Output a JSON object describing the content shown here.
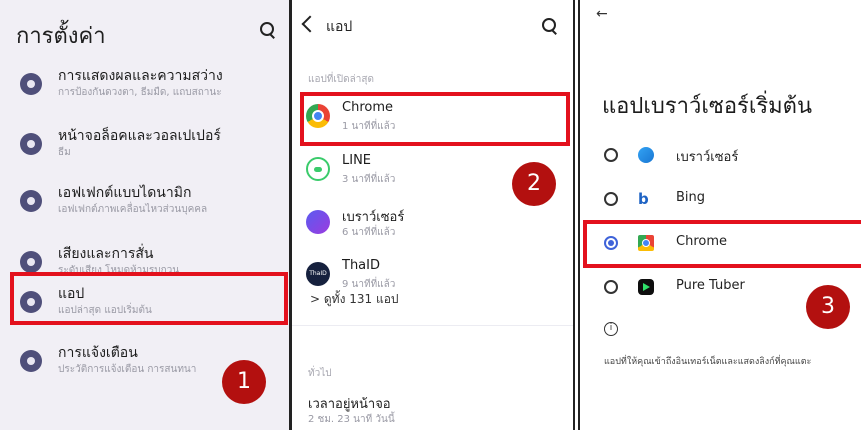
{
  "settings": {
    "title": "การตั้งค่า",
    "items": [
      {
        "title": "การแสดงผลและความสว่าง",
        "subtitle": "การป้องกันดวงตา, ธีมมืด, แถบสถานะ"
      },
      {
        "title": "หน้าจอล็อคและวอลเปเปอร์",
        "subtitle": "ธีม"
      },
      {
        "title": "เอฟเฟกต์แบบไดนามิก",
        "subtitle": "เอฟเฟกต์ภาพเคลื่อนไหวส่วนบุคคล"
      },
      {
        "title": "เสียงและการสั่น",
        "subtitle": "ระดับเสียง โหมดห้ามรบกวน"
      },
      {
        "title": "แอป",
        "subtitle": "แอปล่าสุด แอปเริ่มต้น"
      },
      {
        "title": "การแจ้งเตือน",
        "subtitle": "ประวัติการแจ้งเตือน การสนทนา"
      }
    ]
  },
  "apps": {
    "title": "แอป",
    "recent_header": "แอปที่เปิดล่าสุด",
    "recent": [
      {
        "name": "Chrome",
        "time": "1 นาทีที่แล้ว"
      },
      {
        "name": "LINE",
        "time": "3 นาทีที่แล้ว"
      },
      {
        "name": "เบราว์เซอร์",
        "time": "6 นาทีที่แล้ว"
      },
      {
        "name": "ThaID",
        "time": "9 นาทีที่แล้ว"
      }
    ],
    "thaid_icon_text": "ThaID",
    "see_all": "> ดูทั้ง 131 แอป",
    "general_header": "ทั่วไป",
    "screen_time_title": "เวลาอยู่หน้าจอ",
    "screen_time_value": "2 ชม. 23 นาที วันนี้"
  },
  "default_browser": {
    "back_glyph": "←",
    "title": "แอปเบราว์เซอร์เริ่มต้น",
    "options": [
      {
        "label": "เบราว์เซอร์",
        "selected": false
      },
      {
        "label": "Bing",
        "selected": false
      },
      {
        "label": "Chrome",
        "selected": true
      },
      {
        "label": "Pure Tuber",
        "selected": false
      }
    ],
    "bing_glyph": "b",
    "info_glyph": "i",
    "note": "แอปที่ให้คุณเข้าถึงอินเทอร์เน็ตและแสดงลิงก์ที่คุณแตะ"
  },
  "step_badges": [
    "1",
    "2",
    "3"
  ],
  "colors": {
    "highlight": "#e3111d",
    "badge": "#b3100f",
    "radio_selected": "#3f63d9"
  }
}
